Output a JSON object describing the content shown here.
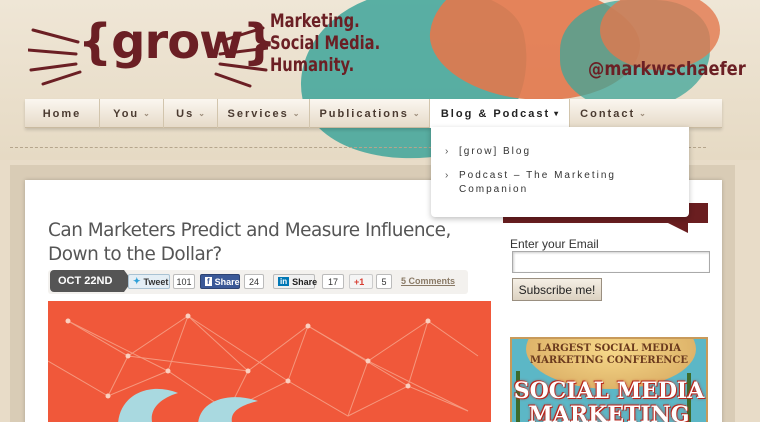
{
  "header": {
    "logo_text": "{grow}",
    "tagline": [
      "Marketing.",
      "Social Media.",
      "Humanity."
    ],
    "handle": "@markwschaefer"
  },
  "nav": {
    "items": [
      {
        "label": "Home",
        "chevron": false
      },
      {
        "label": "You",
        "chevron": true
      },
      {
        "label": "Us",
        "chevron": true
      },
      {
        "label": "Services",
        "chevron": true
      },
      {
        "label": "Publications",
        "chevron": true
      },
      {
        "label": "Blog & Podcast",
        "chevron": true,
        "active": true
      },
      {
        "label": "Contact",
        "chevron": true
      }
    ],
    "dropdown": [
      "[grow] Blog",
      "Podcast – The Marketing Companion"
    ]
  },
  "post": {
    "title": "Can Marketers Predict and Measure Influence, Down to the Dollar?",
    "date": "OCT 22ND",
    "tweet_label": "Tweet",
    "tweet_count": "101",
    "fb_label": "Share",
    "fb_count": "24",
    "li_label": "Share",
    "li_count": "17",
    "gplus_label": "+1",
    "gplus_count": "5",
    "comments": "5 Comments"
  },
  "sidebar": {
    "email_label": "Enter your Email",
    "subscribe_label": "Subscribe me!",
    "ad_top": "LARGEST SOCIAL MEDIA\nMARKETING CONFERENCE",
    "ad_big": "SOCIAL MEDIA\nMARKETING"
  },
  "colors": {
    "brand": "#6b1f24",
    "teal": "#3ea59a",
    "orange": "#e2784d",
    "hero": "#f0583a"
  }
}
